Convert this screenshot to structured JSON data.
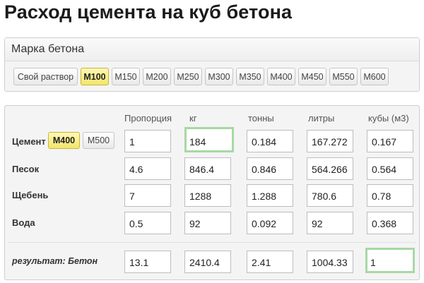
{
  "title": "Расход цемента на куб бетона",
  "grade_panel": {
    "heading": "Марка бетона",
    "options": [
      {
        "label": "Свой раствор",
        "active": false
      },
      {
        "label": "M100",
        "active": true
      },
      {
        "label": "M150",
        "active": false
      },
      {
        "label": "M200",
        "active": false
      },
      {
        "label": "M250",
        "active": false
      },
      {
        "label": "M300",
        "active": false
      },
      {
        "label": "M350",
        "active": false
      },
      {
        "label": "M400",
        "active": false
      },
      {
        "label": "M450",
        "active": false
      },
      {
        "label": "M550",
        "active": false
      },
      {
        "label": "M600",
        "active": false
      }
    ]
  },
  "table": {
    "columns": [
      "Пропорция",
      "кг",
      "тонны",
      "литры",
      "кубы (м3)"
    ],
    "cement_grades": [
      {
        "label": "M400",
        "active": true
      },
      {
        "label": "M500",
        "active": false
      }
    ],
    "rows": [
      {
        "label": "Цемент",
        "values": [
          "1",
          "184",
          "0.184",
          "167.272",
          "0.167"
        ]
      },
      {
        "label": "Песок",
        "values": [
          "4.6",
          "846.4",
          "0.846",
          "564.266",
          "0.564"
        ]
      },
      {
        "label": "Щебень",
        "values": [
          "7",
          "1288",
          "1.288",
          "780.6",
          "0.78"
        ]
      },
      {
        "label": "Вода",
        "values": [
          "0.5",
          "92",
          "0.092",
          "92",
          "0.368"
        ]
      }
    ],
    "result": {
      "label": "результат: Бетон",
      "values": [
        "13.1",
        "2410.4",
        "2.41",
        "1004.33",
        "1"
      ]
    }
  }
}
